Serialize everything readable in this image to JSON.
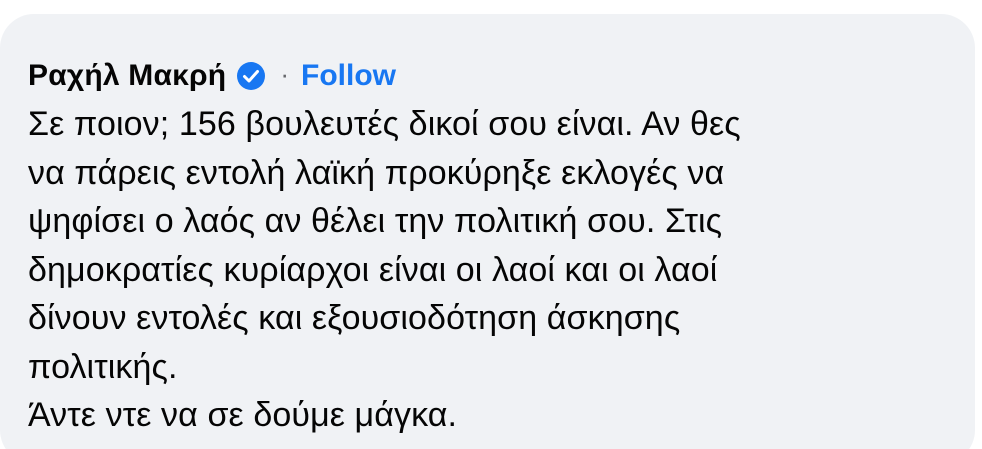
{
  "comment": {
    "author": "Ραχήλ Μακρή",
    "separator": "·",
    "follow_label": "Follow",
    "verified_icon": "verified-badge-icon",
    "text_lines": [
      "Σε ποιον; 156 βουλευτές δικοί σου είναι. Αν θες",
      "να πάρεις εντολή λαϊκή προκύρηξε εκλογές να",
      "ψηφίσει ο λαός αν θέλει την πολιτική σου. Στις",
      "δημοκρατίες κυρίαρχοι είναι οι λαοί και οι λαοί",
      "δίνουν εντολές και εξουσιοδότηση άσκησης",
      "πολιτικής.",
      "Άντε ντε να σε δούμε μάγκα."
    ]
  },
  "colors": {
    "bubble_bg": "#f0f2f5",
    "text": "#050505",
    "link_blue": "#1877f2",
    "secondary": "#65676b"
  }
}
